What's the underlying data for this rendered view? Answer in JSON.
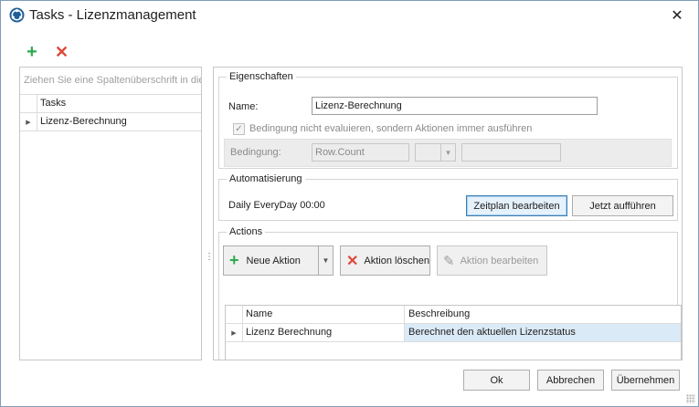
{
  "window": {
    "title": "Tasks - Lizenzmanagement",
    "close_glyph": "✕"
  },
  "toolbar": {
    "add_icon": "plus-icon",
    "delete_icon": "delete-icon"
  },
  "task_grid": {
    "group_hint": "Ziehen Sie eine Spaltenüberschrift in die",
    "header": "Tasks",
    "rows": [
      {
        "name": "Lizenz-Berechnung"
      }
    ]
  },
  "properties": {
    "legend": "Eigenschaften",
    "name_label": "Name:",
    "name_value": "Lizenz-Berechnung",
    "checkbox_label": "Bedingung nicht evaluieren, sondern Aktionen immer ausführen",
    "checkbox_checked": true,
    "condition_label": "Bedingung:",
    "condition_value": "Row.Count",
    "operator_value": "",
    "comparison_value": ""
  },
  "automation": {
    "legend": "Automatisierung",
    "schedule_text": "Daily EveryDay 00:00",
    "edit_schedule_button": "Zeitplan bearbeiten",
    "run_now_button": "Jetzt aufführen"
  },
  "actions": {
    "legend": "Actions",
    "new_action_button": "Neue Aktion",
    "delete_action_button": "Aktion löschen",
    "edit_action_button": "Aktion bearbeiten",
    "columns": [
      "Name",
      "Beschreibung"
    ],
    "rows": [
      {
        "name": "Lizenz Berechnung",
        "description": "Berechnet den aktuellen Lizenzstatus"
      }
    ]
  },
  "footer": {
    "ok_button": "Ok",
    "cancel_button": "Abbrechen",
    "apply_button": "Übernehmen"
  },
  "colors": {
    "add_green": "#2fa84f",
    "delete_red": "#e0483a",
    "selection_blue": "#dbeaf7"
  }
}
